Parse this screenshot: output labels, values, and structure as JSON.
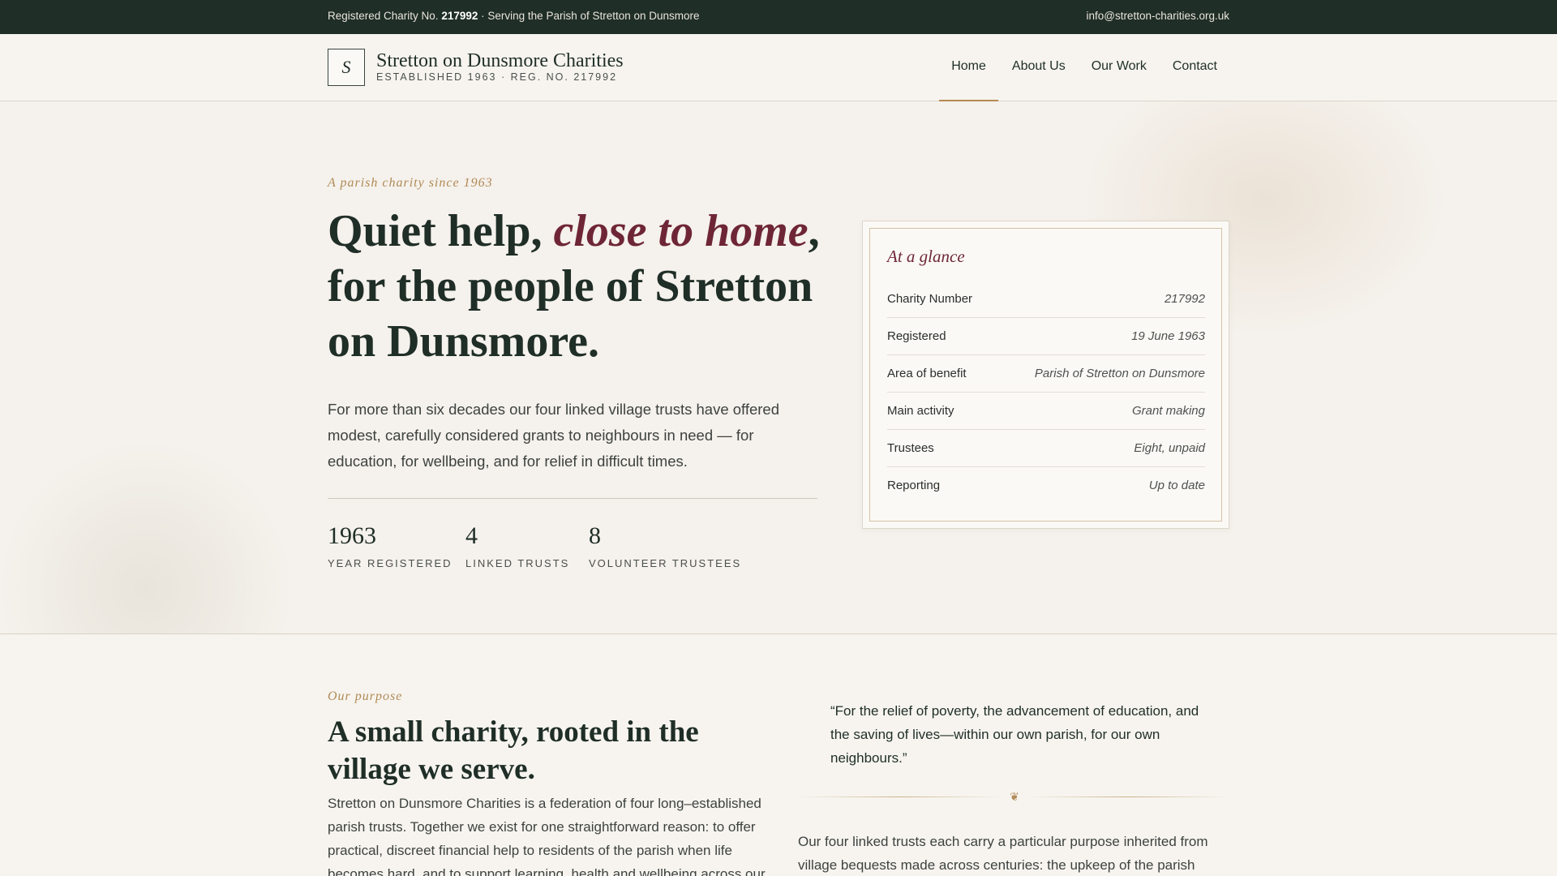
{
  "topbar": {
    "reg_prefix": "Registered Charity No.",
    "reg_number": "217992",
    "reg_suffix": "· Serving the Parish of Stretton on Dunsmore",
    "email": "info@stretton-charities.org.uk"
  },
  "header": {
    "logo_letter": "S",
    "brand_name": "Stretton on Dunsmore Charities",
    "brand_sub": "ESTABLISHED 1963 · REG. NO. 217992",
    "nav": [
      {
        "label": "Home",
        "active": true
      },
      {
        "label": "About Us",
        "active": false
      },
      {
        "label": "Our Work",
        "active": false
      },
      {
        "label": "Contact",
        "active": false
      }
    ]
  },
  "hero": {
    "eyebrow": "A parish charity since 1963",
    "headline_start": "Quiet help, ",
    "headline_emphasis": "close to home",
    "headline_end": ", for the people of Stretton on Dunsmore.",
    "intro": "For more than six decades our four linked village trusts have offered modest, carefully considered grants to neighbours in need — for education, for wellbeing, and for relief in difficult times.",
    "stats": [
      {
        "value": "1963",
        "label": "YEAR REGISTERED"
      },
      {
        "value": "4",
        "label": "LINKED TRUSTS"
      },
      {
        "value": "8",
        "label": "VOLUNTEER TRUSTEES"
      }
    ]
  },
  "glance": {
    "title": "At a glance",
    "rows": [
      {
        "key": "Charity Number",
        "value": "217992"
      },
      {
        "key": "Registered",
        "value": "19 June 1963"
      },
      {
        "key": "Area of benefit",
        "value": "Parish of Stretton on Dunsmore"
      },
      {
        "key": "Main activity",
        "value": "Grant making"
      },
      {
        "key": "Trustees",
        "value": "Eight, unpaid"
      },
      {
        "key": "Reporting",
        "value": "Up to date"
      }
    ]
  },
  "purpose": {
    "eyebrow": "Our purpose",
    "heading": "A small charity, rooted in the village we serve.",
    "text": "Stretton on Dunsmore Charities is a federation of four long–established parish trusts. Together we exist for one straightforward reason: to offer practical, discreet financial help to residents of the parish when life becomes hard, and to support learning, health and wellbeing across our",
    "quote": "“For the relief of poverty, the advancement of education, and the saving of lives—within our own parish, for our own neighbours.”",
    "ornament": "❦",
    "text2": "Our four linked trusts each carry a particular purpose inherited from village bequests made across centuries: the upkeep of the parish church,"
  },
  "colors": {
    "topbar_bg": "#1f2e27",
    "accent_gold": "#b08a56",
    "accent_wine": "#6e2636",
    "page_bg": "#f5f1ec"
  }
}
